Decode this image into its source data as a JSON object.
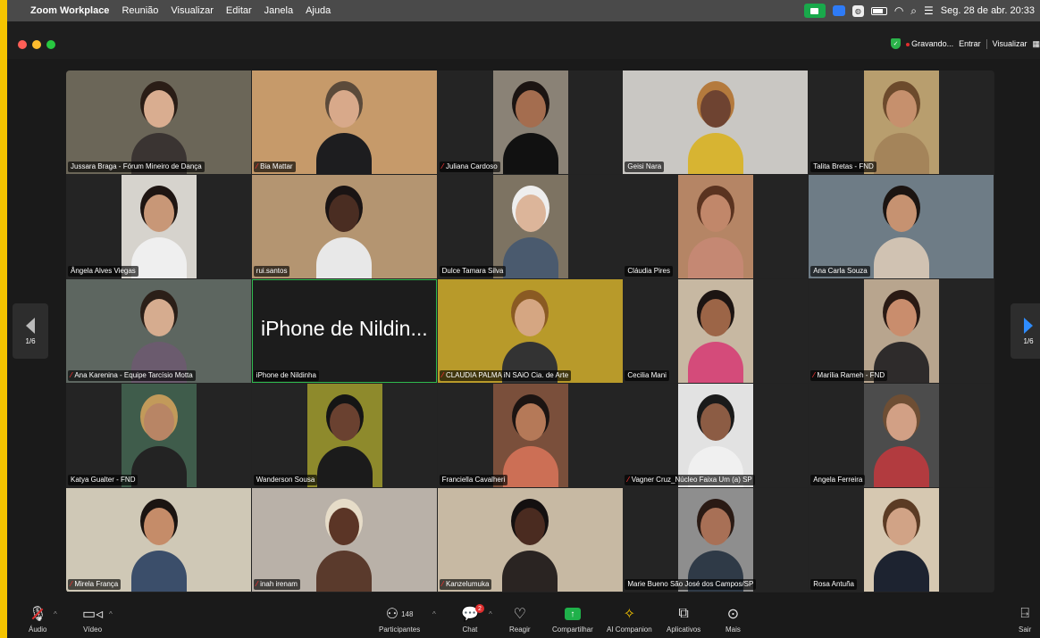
{
  "menubar": {
    "app": "Zoom Workplace",
    "items": [
      "Reunião",
      "Visualizar",
      "Editar",
      "Janela",
      "Ajuda"
    ],
    "clock": "Seg. 28 de abr.  20:33"
  },
  "titlebar": {
    "recording": "Gravando...",
    "enter": "Entrar",
    "view": "Visualizar"
  },
  "pager": {
    "label": "1/6"
  },
  "colors": {
    "active_speaker": "#2fba4f",
    "share": "#1fb14a",
    "record": "#e02e2e",
    "pager_arrow": "#2e8cff"
  },
  "tiles": [
    {
      "name": "Jussara Braga - Fórum Mineiro de Dança",
      "muted": false
    },
    {
      "name": "Bia Mattar",
      "muted": true
    },
    {
      "name": "Juliana Cardoso",
      "muted": true
    },
    {
      "name": "Geisi Nara",
      "muted": false
    },
    {
      "name": "Talita Bretas - FND",
      "muted": false
    },
    {
      "name": "Ângela Alves Viegas",
      "muted": false
    },
    {
      "name": "rui.santos",
      "muted": false
    },
    {
      "name": "Dulce Tamara Silva",
      "muted": false
    },
    {
      "name": "Cláudia Pires",
      "muted": false
    },
    {
      "name": "Ana Carla Souza",
      "muted": false
    },
    {
      "name": "Ana Karenina - Equipe Tarcísio Motta",
      "muted": true
    },
    {
      "name": "iPhone de Nildinha",
      "muted": false,
      "big": "iPhone de Nildin..."
    },
    {
      "name": "CLAUDIA PALMA    iN SAiO Cia. de Arte",
      "muted": true
    },
    {
      "name": "Cecilia Mani",
      "muted": false
    },
    {
      "name": "Marília Rameh - FND",
      "muted": true
    },
    {
      "name": "Katya Gualter - FND",
      "muted": false
    },
    {
      "name": "Wanderson Sousa",
      "muted": false
    },
    {
      "name": "Franciella Cavalheri",
      "muted": false
    },
    {
      "name": "Vagner Cruz_Núcleo Faixa Um (a) SP",
      "muted": true
    },
    {
      "name": "Angela Ferreira",
      "muted": false
    },
    {
      "name": "Mirela França",
      "muted": true
    },
    {
      "name": "inah irenam",
      "muted": true
    },
    {
      "name": "Kanzelumuka",
      "muted": true
    },
    {
      "name": "Marie Bueno  São José dos Campos/SP",
      "muted": false
    },
    {
      "name": "Rosa Antuña",
      "muted": false
    }
  ],
  "toolbar": {
    "audio": "Áudio",
    "video": "Vídeo",
    "participants": "Participantes",
    "participants_count": "148",
    "chat": "Chat",
    "chat_badge": "2",
    "react": "Reagir",
    "share": "Compartilhar",
    "companion": "AI Companion",
    "apps": "Aplicativos",
    "more": "Mais",
    "leave": "Sair"
  }
}
